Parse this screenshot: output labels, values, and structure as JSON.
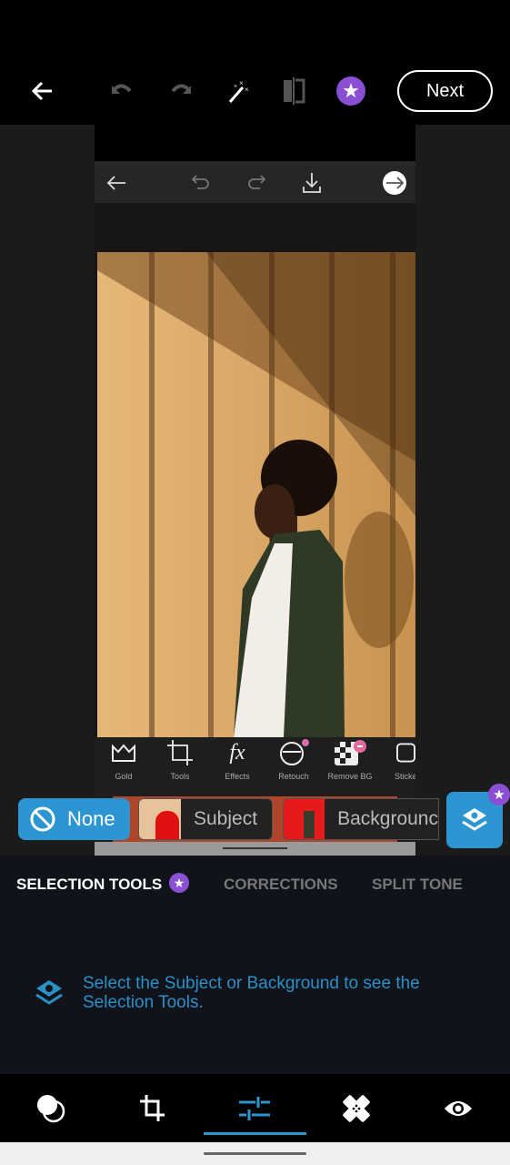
{
  "topbar": {
    "icons": [
      "back-arrow-icon",
      "undo-icon",
      "redo-icon",
      "magic-wand-icon",
      "compare-icon",
      "premium-star-icon"
    ],
    "next_label": "Next"
  },
  "inner_app": {
    "toolbar_icons": [
      "back-arrow-icon",
      "undo-icon",
      "redo-icon",
      "download-icon",
      "forward-circle-icon"
    ],
    "tools": [
      {
        "label": "Gold",
        "icon": "crown-icon"
      },
      {
        "label": "Tools",
        "icon": "crop-icon"
      },
      {
        "label": "Effects",
        "icon": "fx-icon"
      },
      {
        "label": "Retouch",
        "icon": "retouch-face-icon"
      },
      {
        "label": "Remove BG",
        "icon": "remove-bg-icon"
      },
      {
        "label": "Sticke",
        "icon": "sticker-icon"
      }
    ]
  },
  "selection": {
    "none_label": "None",
    "subject_label": "Subject",
    "background_label": "Backgrounc"
  },
  "tabs": [
    {
      "label": "SELECTION TOOLS",
      "active": true,
      "premium": true
    },
    {
      "label": "CORRECTIONS",
      "active": false
    },
    {
      "label": "SPLIT TONE",
      "active": false
    }
  ],
  "hint": "Select the Subject or Background to see the Selection Tools.",
  "bottom_nav": [
    {
      "name": "looks",
      "active": false
    },
    {
      "name": "crop",
      "active": false
    },
    {
      "name": "adjustments",
      "active": true
    },
    {
      "name": "healing",
      "active": false
    },
    {
      "name": "preview",
      "active": false
    }
  ],
  "colors": {
    "accent": "#2d95d2",
    "premium": "#8a4fd2",
    "panel": "#10141a"
  }
}
